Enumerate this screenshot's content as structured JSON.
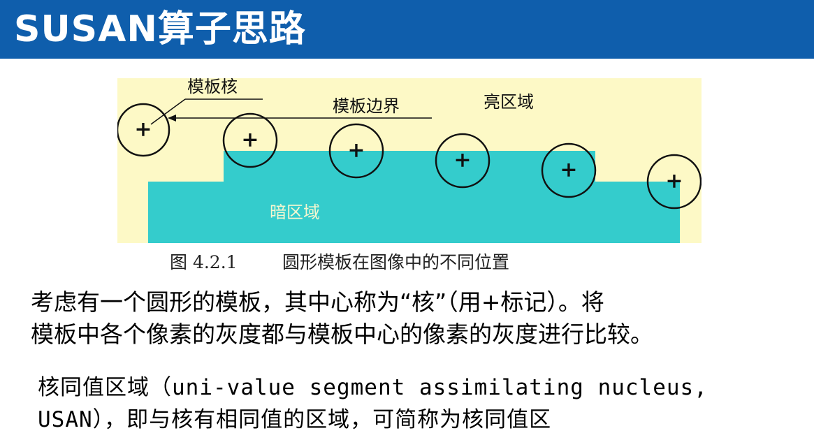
{
  "slide": {
    "title": "SUSAN算子思路"
  },
  "figure": {
    "labels": {
      "kernel": "模板核",
      "boundary": "模板边界",
      "bright_region": "亮区域",
      "dark_region": "暗区域"
    },
    "nucleus_mark": "+",
    "colors": {
      "bright": "#fdf9c6",
      "dark": "#34cccc",
      "dark_label": "#f4f7d0",
      "ink": "#111111"
    },
    "caption_number": "图 4.2.1",
    "caption_text": "圆形模板在图像中的不同位置"
  },
  "body": {
    "para1_line1": "考虑有一个圆形的模板，其中心称为“核”（用+标记）。将",
    "para1_line2": "模板中各个像素的灰度都与模板中心的像素的灰度进行比较。",
    "para2_line1": "核同值区域（uni-value segment assimilating nucleus,",
    "para2_line2": "USAN），即与核有相同值的区域，可简称为核同值区"
  }
}
